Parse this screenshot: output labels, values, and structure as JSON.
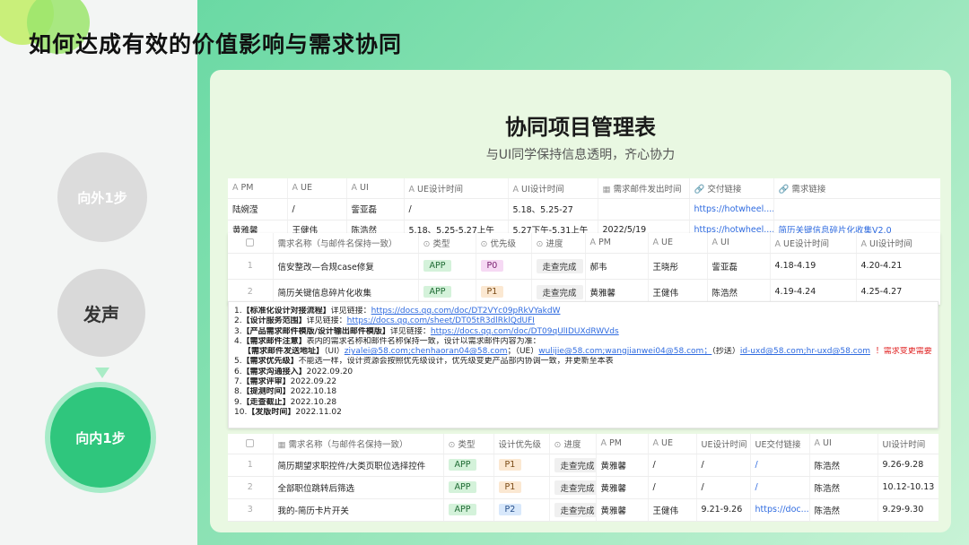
{
  "title": "如何达成有效的价值影响与需求协同",
  "steps": [
    "向外1步",
    "发声",
    "向内1步"
  ],
  "panel": {
    "title": "协同项目管理表",
    "subtitle": "与UI同学保持信息透明，齐心协力"
  },
  "table1": {
    "headers": [
      "PM",
      "UE",
      "UI",
      "UE设计时间",
      "UI设计时间",
      "需求邮件发出时间",
      "交付链接",
      "需求链接"
    ],
    "header_icons": [
      "A",
      "A",
      "A",
      "A",
      "A",
      "▦",
      "🔗",
      "🔗"
    ],
    "rows": [
      [
        "陆婉滢",
        "/",
        "訾亚磊",
        "/",
        "5.18、5.25-27",
        "",
        "https://hotwheel....",
        ""
      ],
      [
        "黄雅馨",
        "王健伟",
        "陈浩然",
        "5.18、5.25-5.27上午",
        "5.27下午-5.31上午",
        "2022/5/19",
        "https://hotwheel....",
        "简历关键信息碎片化收集V2.0"
      ]
    ]
  },
  "table2": {
    "headers": [
      "",
      "需求名称（与邮件名保持一致）",
      "类型",
      "优先级",
      "进度",
      "PM",
      "UE",
      "UI",
      "UE设计时间",
      "UI设计时间"
    ],
    "header_icons": [
      "",
      "",
      "⊙",
      "⊙",
      "⊙",
      "A",
      "A",
      "A",
      "A",
      "A"
    ],
    "rows": [
      [
        "1",
        "信安整改—合规case修复",
        "APP",
        "P0",
        "走查完成",
        "郝韦",
        "王晓彤",
        "訾亚磊",
        "4.18-4.19",
        "4.20-4.21"
      ],
      [
        "2",
        "简历关键信息碎片化收集",
        "APP",
        "P1",
        "走查完成",
        "黄雅馨",
        "王健伟",
        "陈浩然",
        "4.19-4.24",
        "4.25-4.27"
      ]
    ]
  },
  "notes": {
    "l1": {
      "label": "【标准化设计对接流程】",
      "text": "详见链接：",
      "link": "https://docs.qq.com/doc/DT2VYc09pRkVYakdW"
    },
    "l2": {
      "label": "【设计服务范围】",
      "text": "详见链接：",
      "link": "https://docs.qq.com/sheet/DT05tR3dlRklQdUFI"
    },
    "l3": {
      "label": "【产品需求邮件模版/设计输出邮件模版】",
      "text": "详见链接：",
      "link": "https://docs.qq.com/doc/DT09qUlIDUXdRWVds"
    },
    "l4": {
      "label": "【需求邮件注意】",
      "text": "表内的需求名称和邮件名称保持一致，设计以需求邮件内容为准："
    },
    "l4b": {
      "label": "【需求邮件发送地址】",
      "ui_prefix": "（UI）",
      "ui_emails": "ziyalei@58.com;chenhaoran04@58.com",
      "ue_prefix": "；（UE）",
      "ue_emails": "wulijie@58.com;wangjianwei04@58.com；",
      "cc_prefix": "（抄送）",
      "cc_emails": "id-uxd@58.com;hr-uxd@58.com",
      "warning": "！需求变更需要重新发邮件"
    },
    "l5": {
      "label": "【需求优先级】",
      "text": "不能选一样，设计资源会按照优先级设计，优先级变更产品部内协调一致，并更新至本表"
    },
    "l6": {
      "label": "【需求沟通接入】",
      "text": "2022.09.20"
    },
    "l7": {
      "label": "【需求评审】",
      "text": "2022.09.22"
    },
    "l8": {
      "label": "【提测时间】",
      "text": "2022.10.18"
    },
    "l9": {
      "label": "【走查截止】",
      "text": "2022.10.28"
    },
    "l10": {
      "label": "【发版时间】",
      "text": "2022.11.02"
    }
  },
  "table3": {
    "headers": [
      "",
      "需求名称（与邮件名保持一致）",
      "类型",
      "设计优先级",
      "进度",
      "PM",
      "UE",
      "UE设计时间",
      "UE交付链接",
      "UI",
      "UI设计时间"
    ],
    "header_icons": [
      "",
      "▦",
      "⊙",
      "",
      "⊙",
      "A",
      "A",
      "",
      "",
      "A",
      ""
    ],
    "rows": [
      [
        "1",
        "简历期望求职控件/大类页职位选择控件",
        "APP",
        "P1",
        "走查完成",
        "黄雅馨",
        "/",
        "/",
        "/",
        "陈浩然",
        "9.26-9.28"
      ],
      [
        "2",
        "全部职位跳转后筛选",
        "APP",
        "P1",
        "走查完成",
        "黄雅馨",
        "/",
        "/",
        "/",
        "陈浩然",
        "10.12-10.13"
      ],
      [
        "3",
        "我的-简历卡片开关",
        "APP",
        "P2",
        "走查完成",
        "黄雅馨",
        "王健伟",
        "9.21-9.26",
        "https://doc...",
        "陈浩然",
        "9.29-9.30"
      ]
    ]
  },
  "colors": {
    "accent": "#2fc67d",
    "panel": "#e9f8e2",
    "link": "#2f6be0",
    "warning": "#e02424"
  }
}
